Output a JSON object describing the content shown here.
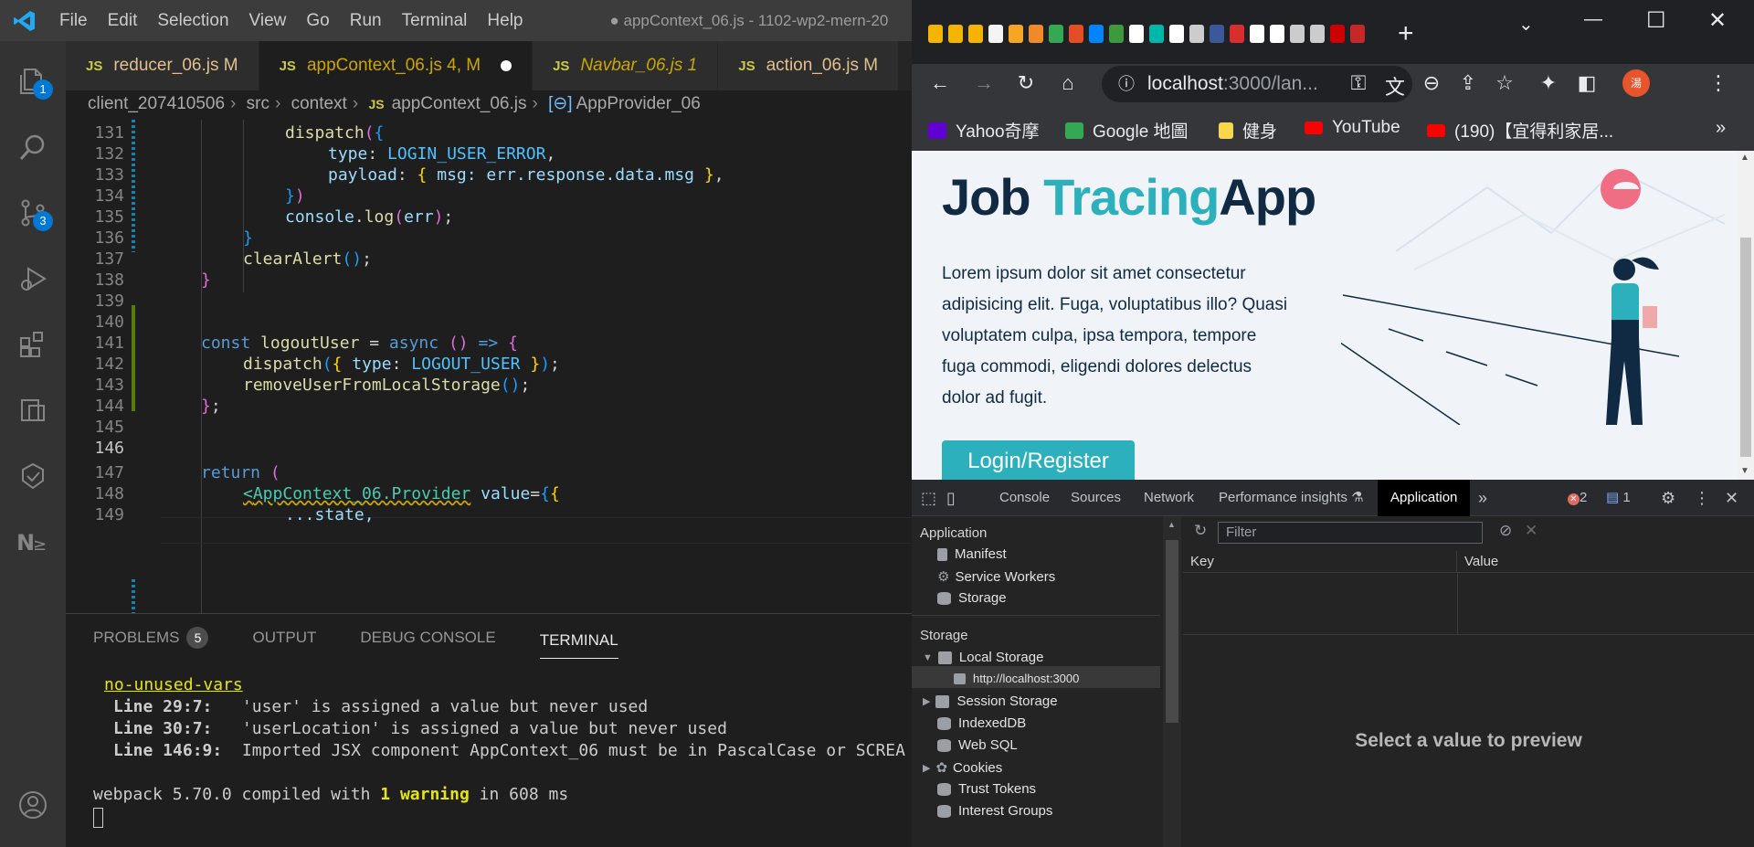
{
  "vscode": {
    "title": "● appContext_06.js - 1102-wp2-mern-20",
    "menu": [
      "File",
      "Edit",
      "Selection",
      "View",
      "Go",
      "Run",
      "Terminal",
      "Help"
    ],
    "activity_badges": {
      "explorer": "1",
      "scm": "3"
    },
    "tabs": [
      {
        "name": "reducer_06.js",
        "status": "M"
      },
      {
        "name": "appContext_06.js",
        "status": "4, M"
      },
      {
        "name": "Navbar_06.js",
        "status": "1"
      },
      {
        "name": "action_06.js",
        "status": "M"
      }
    ],
    "breadcrumb": [
      "client_207410506",
      "src",
      "context",
      "appContext_06.js",
      "AppProvider_06"
    ],
    "line_numbers": [
      "131",
      "132",
      "133",
      "134",
      "135",
      "136",
      "137",
      "138",
      "139",
      "140",
      "141",
      "142",
      "143",
      "144",
      "145",
      "146",
      "147",
      "148",
      "149"
    ],
    "code": {
      "l131": "dispatch",
      "l132_key": "type",
      "l132_val": "LOGIN_USER_ERROR",
      "l133_key": "payload",
      "l133_val": "msg: err.response.data.msg",
      "l135_obj": "console",
      "l135_fn": "log",
      "l135_arg": "err",
      "l137": "clearAlert",
      "l141_const": "const",
      "l141_name": "logoutUser",
      "l141_async": "async",
      "l142_fn": "dispatch",
      "l142_key": "type",
      "l142_val": "LOGOUT_USER",
      "l143": "removeUserFromLocalStorage",
      "l147": "return",
      "l148_tag": "AppContext_06.Provider",
      "l148_attr": "value",
      "l149": "...state,"
    },
    "panel": {
      "tabs": [
        "PROBLEMS",
        "OUTPUT",
        "DEBUG CONSOLE",
        "TERMINAL"
      ],
      "problems_count": "5",
      "terminal": {
        "rule": "no-unused-vars",
        "warn1_loc": "Line 29:7:",
        "warn1_msg": "'user' is assigned a value but never used",
        "warn2_loc": "Line 30:7:",
        "warn2_msg": "'userLocation' is assigned a value but never used",
        "warn3_loc": "Line 146:9:",
        "warn3_msg": "Imported JSX component AppContext_06 must be in PascalCase or SCREA",
        "compiled_pre": "webpack 5.70.0 compiled with ",
        "compiled_warn": "1 warning",
        "compiled_post": " in 608 ms"
      }
    }
  },
  "chrome": {
    "url_host": "localhost",
    "url_rest": ":3000/lan...",
    "avatar_text": "湯",
    "bookmarks": [
      "Yahoo奇摩",
      "Google 地圖",
      "健身",
      "YouTube",
      "(190)【宜得利家居..."
    ],
    "page": {
      "logo_part1": "Job ",
      "logo_part2": "Tracing",
      "logo_part3": "App",
      "text": "Lorem ipsum dolor sit amet consectetur adipisicing elit. Fuga, voluptatibus illo? Quasi voluptatem culpa, ipsa tempora, tempore fuga commodi, eligendi dolores delectus dolor ad fugit.",
      "button": "Login/Register"
    },
    "devtools": {
      "tabs": [
        "Console",
        "Sources",
        "Network",
        "Performance insights",
        "Application"
      ],
      "errors": "2",
      "messages": "1",
      "sections": {
        "application": "Application",
        "manifest": "Manifest",
        "service_workers": "Service Workers",
        "storage_item": "Storage",
        "storage_header": "Storage",
        "local_storage": "Local Storage",
        "local_origin": "http://localhost:3000",
        "session_storage": "Session Storage",
        "indexeddb": "IndexedDB",
        "websql": "Web SQL",
        "cookies": "Cookies",
        "trust_tokens": "Trust Tokens",
        "interest_groups": "Interest Groups"
      },
      "filter_placeholder": "Filter",
      "col_key": "Key",
      "col_value": "Value",
      "preview": "Select a value to preview"
    }
  }
}
